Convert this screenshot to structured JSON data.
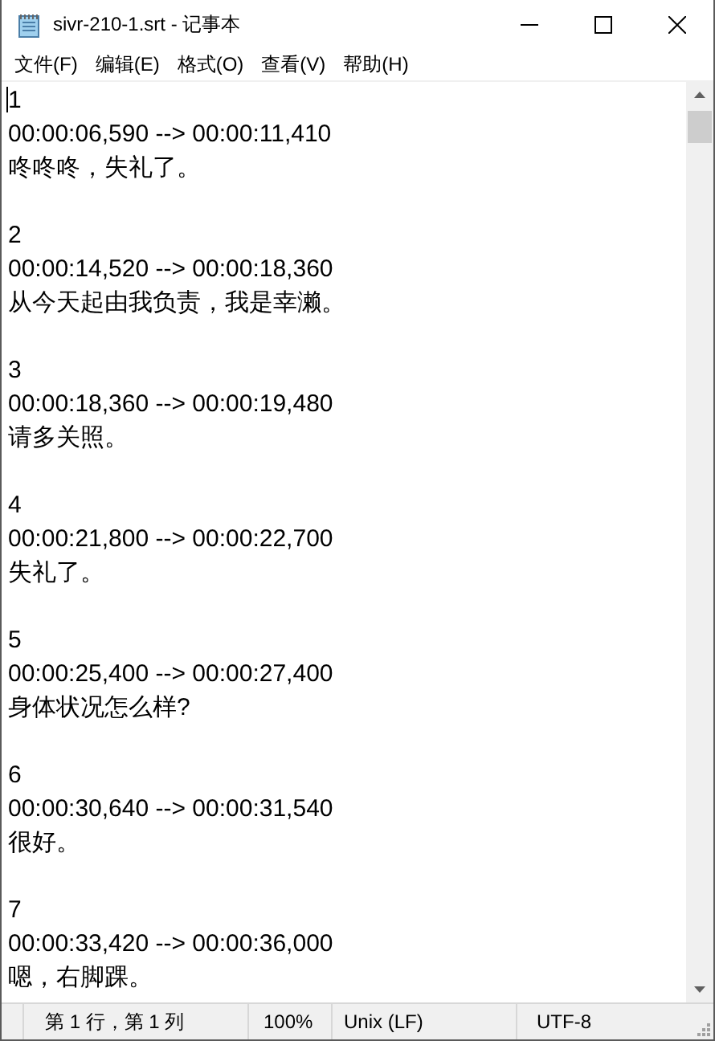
{
  "window": {
    "title": "sivr-210-1.srt - 记事本"
  },
  "menu": [
    "文件(F)",
    "编辑(E)",
    "格式(O)",
    "查看(V)",
    "帮助(H)"
  ],
  "subtitles": [
    {
      "index": "1",
      "time": "00:00:06,590 --> 00:00:11,410",
      "text": "咚咚咚，失礼了。"
    },
    {
      "index": "2",
      "time": "00:00:14,520 --> 00:00:18,360",
      "text": "从今天起由我负责，我是幸濑。"
    },
    {
      "index": "3",
      "time": "00:00:18,360 --> 00:00:19,480",
      "text": "请多关照。"
    },
    {
      "index": "4",
      "time": "00:00:21,800 --> 00:00:22,700",
      "text": "失礼了。"
    },
    {
      "index": "5",
      "time": "00:00:25,400 --> 00:00:27,400",
      "text": "身体状况怎么样?"
    },
    {
      "index": "6",
      "time": "00:00:30,640 --> 00:00:31,540",
      "text": "很好。"
    },
    {
      "index": "7",
      "time": "00:00:33,420 --> 00:00:36,000",
      "text": "嗯，右脚踝。"
    }
  ],
  "status_bar": {
    "position": "第 1 行，第 1 列",
    "zoom": "100%",
    "line_ending": "Unix (LF)",
    "encoding": "UTF-8"
  }
}
